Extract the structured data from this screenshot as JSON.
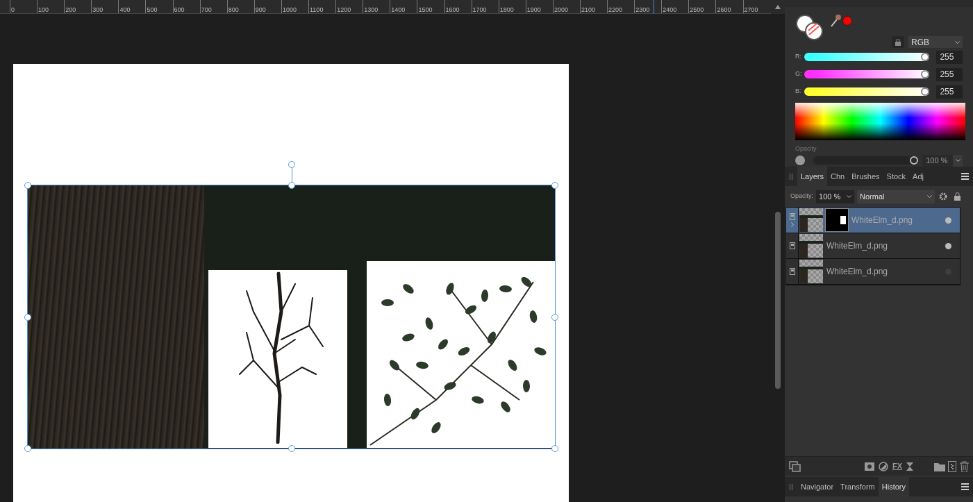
{
  "ruler": {
    "labels": [
      "0",
      "100",
      "200",
      "300",
      "400",
      "500",
      "600",
      "700",
      "800",
      "900",
      "1000",
      "1100",
      "1200",
      "1300",
      "1400",
      "1500",
      "1600",
      "1700",
      "1800",
      "1900",
      "2000",
      "2100",
      "2200",
      "2300",
      "2400",
      "2500",
      "2600",
      "2700"
    ]
  },
  "color_panel": {
    "mode": "RGB",
    "channels": [
      {
        "label": "R:",
        "value": "255",
        "level": 1,
        "color": "#40ffff"
      },
      {
        "label": "G:",
        "value": "255",
        "level": 1,
        "color": "#ff30ff"
      },
      {
        "label": "B:",
        "value": "255",
        "level": 1,
        "color": "#ffff30"
      }
    ],
    "opacity": {
      "label": "Opacity",
      "value": "100 %",
      "level": 1
    }
  },
  "layers_panel": {
    "tabs": [
      {
        "label": "Layers",
        "selected": true
      },
      {
        "label": "Chn",
        "selected": false
      },
      {
        "label": "Brushes",
        "selected": false
      },
      {
        "label": "Stock",
        "selected": false
      },
      {
        "label": "Adj",
        "selected": false
      }
    ],
    "fx_label": "FX",
    "opacity_label": "Opacity:",
    "opacity_value": "100 %",
    "blend_mode": "Normal",
    "layers": [
      {
        "name": "WhiteElm_d.png",
        "selected": true,
        "has_mask": true,
        "visible": true
      },
      {
        "name": "WhiteElm_d.png",
        "selected": false,
        "has_mask": false,
        "visible": true
      },
      {
        "name": "WhiteElm_d.png",
        "selected": false,
        "has_mask": false,
        "visible": false
      }
    ]
  },
  "bottom_panel": {
    "tabs": [
      {
        "label": "Navigator",
        "selected": false
      },
      {
        "label": "Transform",
        "selected": false
      },
      {
        "label": "History",
        "selected": true
      }
    ]
  }
}
